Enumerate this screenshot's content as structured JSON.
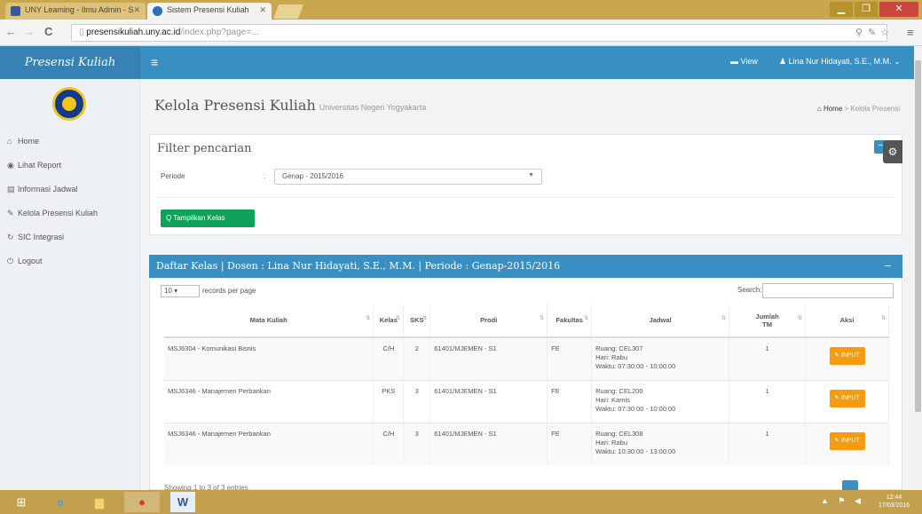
{
  "browser": {
    "tabs": [
      {
        "label": "UNY Leaming - Ilmu Admin - S",
        "color": "#3b5998"
      },
      {
        "label": "Sistem Presensi Kuliah",
        "color": "#2a70b8"
      }
    ],
    "url_host": "presensikuliah.uny.ac.id",
    "url_path": "/index.php?page=...",
    "controls": {
      "back": "←",
      "forward": "→",
      "reload": "C",
      "min": "▁",
      "max": "❐",
      "close": "✕",
      "menu": "≡"
    }
  },
  "app": {
    "brand": "Presensi Kuliah",
    "menu_icon": "≡",
    "header_view": "View",
    "header_user": "Lina Nur Hidayati, S.E., M.M."
  },
  "sidebar": {
    "items": [
      {
        "icon": "home-icon",
        "glyph": "⌂",
        "label": "Home"
      },
      {
        "icon": "report-icon",
        "glyph": "◉",
        "label": "Lihat Report"
      },
      {
        "icon": "schedule-icon",
        "glyph": "▤",
        "label": "Informasi Jadwal"
      },
      {
        "icon": "edit-icon",
        "glyph": "✎",
        "label": "Kelola Presensi Kuliah"
      },
      {
        "icon": "sync-icon",
        "glyph": "↻",
        "label": "SIC Integrasi"
      },
      {
        "icon": "logout-icon",
        "glyph": "⏻",
        "label": "Logout"
      }
    ]
  },
  "page": {
    "title": "Kelola Presensi Kuliah",
    "subtitle": "Universitas Negeri Yogyakarta",
    "breadcrumb_home": "Home",
    "breadcrumb_current": "Kelola Presensi"
  },
  "filter": {
    "title": "Filter pencarian",
    "periode_label": "Periode",
    "colon": ":",
    "periode_value": "Genap - 2015/2016",
    "show_button": "Q Tampilkan Kelas",
    "collapse": "−",
    "gear": "⚙"
  },
  "list": {
    "header": "Daftar Kelas | Dosen : Lina Nur Hidayati, S.E., M.M. | Periode : Genap-2015/2016",
    "header_btn": "−",
    "length_value": "10",
    "length_suffix": "records per page",
    "search_label": "Search:",
    "columns": [
      "Mata Kuliah",
      "Kelas",
      "SKS",
      "Prodi",
      "Fakultas",
      "Jadwal",
      "Jumlah TM",
      "Aksi"
    ],
    "rows": [
      {
        "mk": "MSJ6304 - Komunikasi Bisnis",
        "kelas": "C/H",
        "sks": "2",
        "prodi": "61401/MJEMEN - S1",
        "fakultas": "FE",
        "jadwal": [
          "Ruang: CEL307",
          "Hari: Rabu",
          "Waktu: 07:30:00 - 10:00:00"
        ],
        "tm": "1",
        "aksi": "INPUT"
      },
      {
        "mk": "MSJ6346 - Manajemen Perbankan",
        "kelas": "PKS",
        "sks": "3",
        "prodi": "61401/MJEMEN - S1",
        "fakultas": "FE",
        "jadwal": [
          "Ruang: CEL200",
          "Hari: Kamis",
          "Waktu: 07:30:00 - 10:00:00"
        ],
        "tm": "1",
        "aksi": "INPUT"
      },
      {
        "mk": "MSJ6346 - Manajemen Perbankan",
        "kelas": "C/H",
        "sks": "3",
        "prodi": "61401/MJEMEN - S1",
        "fakultas": "FE",
        "jadwal": [
          "Ruang: CEL308",
          "Hari: Rabu",
          "Waktu: 10:30:00 - 13:00:00"
        ],
        "tm": "1",
        "aksi": "INPUT"
      }
    ],
    "info": "Showing 1 to 3 of 3 entries"
  },
  "taskbar": {
    "start": "⊞",
    "ie": "e",
    "explorer": "▆",
    "chrome": "●",
    "word": "W",
    "tray": "▲ ⚑ ◀",
    "time": "12:44",
    "date": "17/03/2016"
  }
}
